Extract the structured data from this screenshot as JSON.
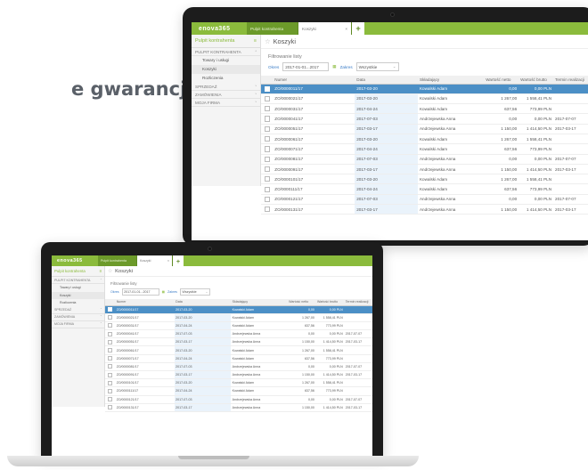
{
  "headline": "e gwarancji.",
  "app": {
    "logo": "enova365",
    "tabs": [
      {
        "label": "Pulpit kontrahenta"
      },
      {
        "label": "Koszyki"
      }
    ],
    "add_tab_label": "+",
    "left_panel": {
      "title": "Pulpit kontrahenta",
      "sections": [
        {
          "label": "PULPIT KONTRAHENTA",
          "items": [
            "Towary i usługi",
            "Koszyki",
            "Rozliczenia"
          ]
        },
        {
          "label": "SPRZEDAŻ",
          "items": []
        },
        {
          "label": "ZAMÓWIENIA",
          "items": []
        },
        {
          "label": "MOJA FIRMA",
          "items": []
        }
      ]
    },
    "breadcrumb": "Koszyki",
    "filter": {
      "title": "Filtrowanie listy",
      "okres_label": "Okres",
      "okres_value": "2017-01-01...2017",
      "status_label": "Zakres",
      "status_value": "Wszystkie"
    },
    "table": {
      "columns": [
        "Numer",
        "Data",
        "Składający",
        "Wartość netto",
        "Wartość brutto",
        "Termin realizacji"
      ],
      "rows": [
        [
          "ZO/0000011/17",
          "2017-03-20",
          "Kowalski Adam",
          "0,00",
          "0,00 PLN",
          ""
        ],
        [
          "ZO/0000021/17",
          "2017-03-20",
          "Kowalski Adam",
          "1 267,00",
          "1 558,41 PLN",
          ""
        ],
        [
          "ZO/0000031/17",
          "2017-04-24",
          "Kowalski Adam",
          "637,56",
          "773,99 PLN",
          ""
        ],
        [
          "ZO/0000041/17",
          "2017-07-03",
          "Andrzejewska Anna",
          "0,00",
          "0,00 PLN",
          "2017-07-07"
        ],
        [
          "ZO/0000051/17",
          "2017-03-17",
          "Andrzejewska Anna",
          "1 150,00",
          "1 414,50 PLN",
          "2017-03-17"
        ],
        [
          "ZO/0000061/17",
          "2017-03-20",
          "Kowalski Adam",
          "1 267,00",
          "1 558,41 PLN",
          ""
        ],
        [
          "ZO/0000071/17",
          "2017-04-24",
          "Kowalski Adam",
          "637,56",
          "773,99 PLN",
          ""
        ],
        [
          "ZO/0000081/17",
          "2017-07-03",
          "Andrzejewska Anna",
          "0,00",
          "0,00 PLN",
          "2017-07-07"
        ],
        [
          "ZO/0000091/17",
          "2017-03-17",
          "Andrzejewska Anna",
          "1 150,00",
          "1 414,50 PLN",
          "2017-03-17"
        ],
        [
          "ZO/0000101/17",
          "2017-03-20",
          "Kowalski Adam",
          "1 267,00",
          "1 558,41 PLN",
          ""
        ],
        [
          "ZO/0000111/17",
          "2017-04-24",
          "Kowalski Adam",
          "637,56",
          "773,99 PLN",
          ""
        ],
        [
          "ZO/0000121/17",
          "2017-07-03",
          "Andrzejewska Anna",
          "0,00",
          "0,00 PLN",
          "2017-07-07"
        ],
        [
          "ZO/0000131/17",
          "2017-03-17",
          "Andrzejewska Anna",
          "1 150,00",
          "1 414,50 PLN",
          "2017-03-17"
        ]
      ],
      "selected_row": 0
    },
    "colors": {
      "brand_green": "#8bbb3c",
      "selection_blue": "#4b8fc6"
    }
  }
}
